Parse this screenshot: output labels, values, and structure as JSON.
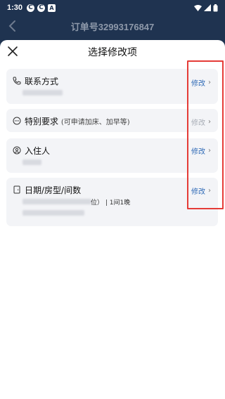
{
  "status_bar": {
    "time": "1:30",
    "icons": [
      "notification-icon",
      "notification-icon",
      "app-icon"
    ]
  },
  "header": {
    "title": "订单号32993176847"
  },
  "sheet": {
    "title": "选择修改项",
    "items": [
      {
        "label": "联系方式",
        "hint": "",
        "action": "修改",
        "enabled": true
      },
      {
        "label": "特别要求",
        "hint": "(可申请加床、加早等)",
        "action": "修改",
        "enabled": false
      },
      {
        "label": "入住人",
        "hint": "",
        "action": "修改",
        "enabled": true
      },
      {
        "label": "日期/房型/间数",
        "hint": "",
        "action": "修改",
        "enabled": true,
        "detail": "位） | 1间1晚"
      }
    ]
  },
  "colors": {
    "link": "#2f6ab6",
    "disabled": "#a8adb6",
    "highlight": "#e53b37",
    "card_bg": "#f3f4f7",
    "header_bg": "#1f3350"
  }
}
